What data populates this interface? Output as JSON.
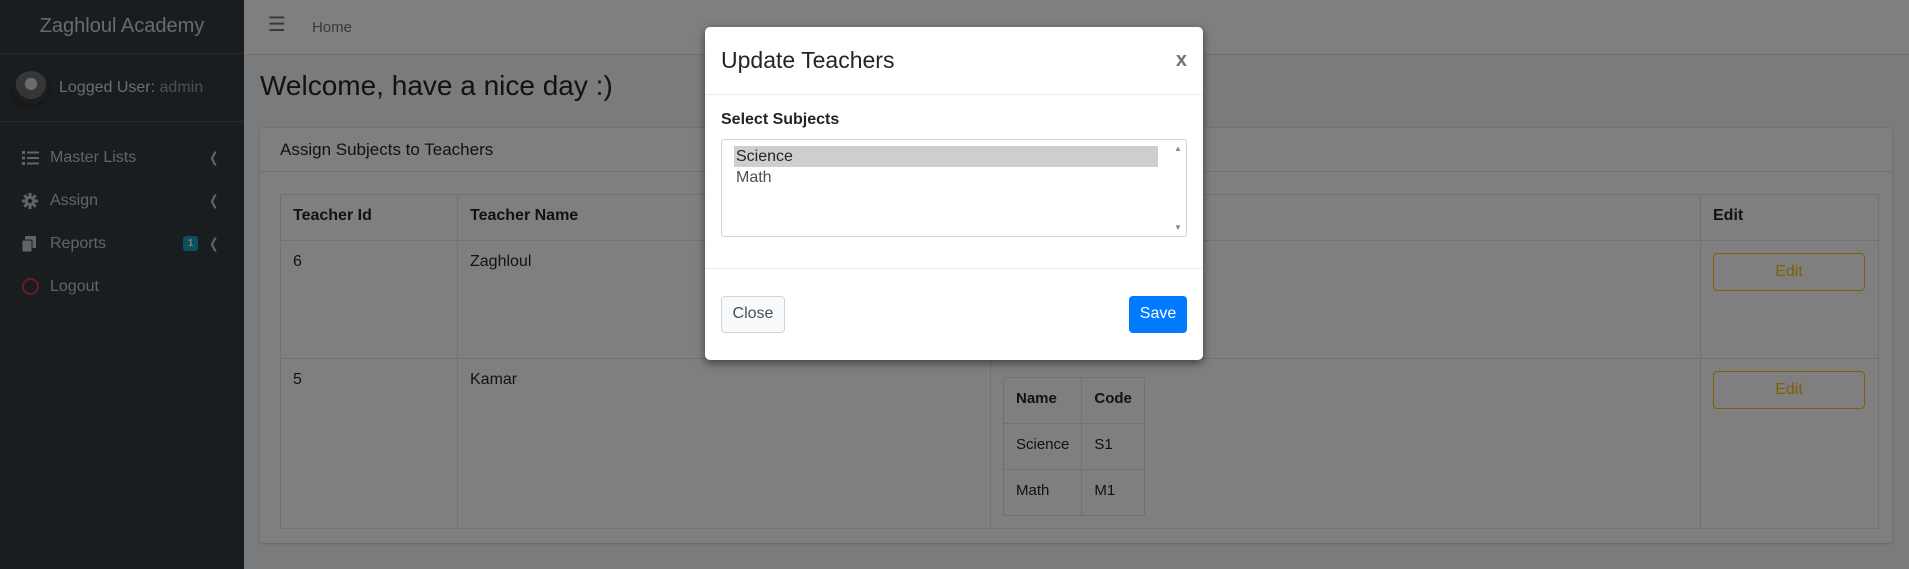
{
  "app": {
    "brand": "Zaghloul Academy"
  },
  "user": {
    "label": "Logged User:",
    "name": "admin"
  },
  "sidebar": {
    "items": [
      {
        "label": "Master Lists",
        "icon": "list-icon"
      },
      {
        "label": "Assign",
        "icon": "gear-icon"
      },
      {
        "label": "Reports",
        "icon": "copy-icon",
        "badge": "1"
      },
      {
        "label": "Logout",
        "icon": "circle-icon"
      }
    ]
  },
  "topbar": {
    "home": "Home"
  },
  "page": {
    "welcome": "Welcome, have a nice day :)"
  },
  "card": {
    "title": "Assign Subjects to Teachers",
    "headers": [
      "Teacher Id",
      "Teacher Name",
      "",
      "Edit"
    ],
    "rows": [
      {
        "id": "6",
        "name": "Zaghloul",
        "edit": "Edit"
      },
      {
        "id": "5",
        "name": "Kamar",
        "edit": "Edit",
        "subjects_headers": [
          "Name",
          "Code"
        ],
        "subjects": [
          [
            "Science",
            "S1"
          ],
          [
            "Math",
            "M1"
          ]
        ]
      }
    ]
  },
  "modal": {
    "title": "Update Teachers",
    "close_x": "x",
    "select_label": "Select Subjects",
    "options": [
      "Science",
      "Math"
    ],
    "selected": "Science",
    "close_label": "Close",
    "save_label": "Save"
  },
  "colors": {
    "sidebar": "#343a40",
    "primary": "#007bff",
    "warning": "#ffc107",
    "badge": "#17a2b8",
    "logout": "#dc3545"
  }
}
